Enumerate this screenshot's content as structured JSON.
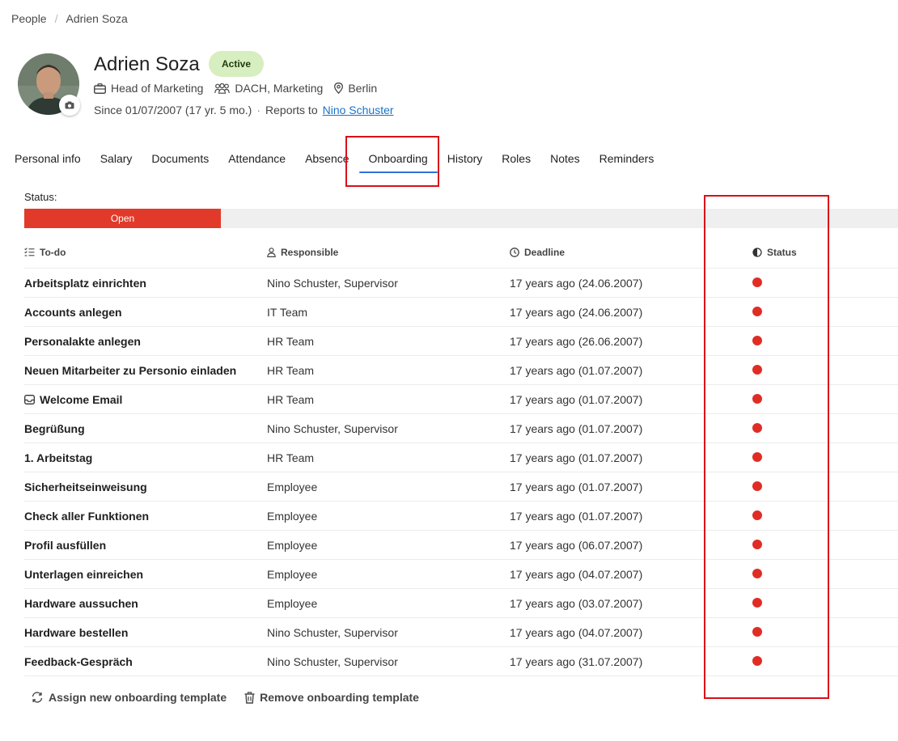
{
  "breadcrumb": {
    "root": "People",
    "current": "Adrien Soza"
  },
  "profile": {
    "name": "Adrien Soza",
    "status_badge": "Active",
    "position": "Head of Marketing",
    "department": "DACH, Marketing",
    "office": "Berlin",
    "since": "Since 01/07/2007 (17 yr. 5 mo.)",
    "reports_to_label": "Reports to",
    "reports_to_name": "Nino Schuster",
    "icons": {
      "position": "briefcase-icon",
      "department": "team-icon",
      "office": "location-pin-icon",
      "avatar_edit": "camera-icon"
    }
  },
  "tabs": [
    {
      "label": "Personal info"
    },
    {
      "label": "Salary"
    },
    {
      "label": "Documents"
    },
    {
      "label": "Attendance"
    },
    {
      "label": "Absence"
    },
    {
      "label": "Onboarding"
    },
    {
      "label": "History"
    },
    {
      "label": "Roles"
    },
    {
      "label": "Notes"
    },
    {
      "label": "Reminders"
    }
  ],
  "active_tab": "Onboarding",
  "status": {
    "label": "Status:",
    "value": "Open",
    "progress_fraction": 0.225,
    "color": "#e23a2a"
  },
  "table": {
    "headers": {
      "todo": "To-do",
      "responsible": "Responsible",
      "deadline": "Deadline",
      "status": "Status"
    },
    "rows": [
      {
        "todo": "Arbeitsplatz einrichten",
        "responsible": "Nino Schuster, Supervisor",
        "deadline": "17 years ago (24.06.2007)"
      },
      {
        "todo": "Accounts anlegen",
        "responsible": "IT Team",
        "deadline": "17 years ago (24.06.2007)"
      },
      {
        "todo": "Personalakte anlegen",
        "responsible": "HR Team",
        "deadline": "17 years ago (26.06.2007)"
      },
      {
        "todo": "Neuen Mitarbeiter zu Personio einladen",
        "responsible": "HR Team",
        "deadline": "17 years ago (01.07.2007)"
      },
      {
        "todo": "Welcome Email",
        "responsible": "HR Team",
        "deadline": "17 years ago (01.07.2007)",
        "icon": "inbox-icon"
      },
      {
        "todo": "Begrüßung",
        "responsible": "Nino Schuster, Supervisor",
        "deadline": "17 years ago (01.07.2007)"
      },
      {
        "todo": "1. Arbeitstag",
        "responsible": "HR Team",
        "deadline": "17 years ago (01.07.2007)"
      },
      {
        "todo": "Sicherheitseinweisung",
        "responsible": "Employee",
        "deadline": "17 years ago (01.07.2007)"
      },
      {
        "todo": "Check aller Funktionen",
        "responsible": "Employee",
        "deadline": "17 years ago (01.07.2007)"
      },
      {
        "todo": "Profil ausfüllen",
        "responsible": "Employee",
        "deadline": "17 years ago (06.07.2007)"
      },
      {
        "todo": "Unterlagen einreichen",
        "responsible": "Employee",
        "deadline": "17 years ago (04.07.2007)"
      },
      {
        "todo": "Hardware aussuchen",
        "responsible": "Employee",
        "deadline": "17 years ago (03.07.2007)"
      },
      {
        "todo": "Hardware bestellen",
        "responsible": "Nino Schuster, Supervisor",
        "deadline": "17 years ago (04.07.2007)"
      },
      {
        "todo": "Feedback-Gespräch",
        "responsible": "Nino Schuster, Supervisor",
        "deadline": "17 years ago (31.07.2007)"
      }
    ],
    "status_dot_color": "#df2d25"
  },
  "actions": {
    "assign": "Assign new onboarding template",
    "remove": "Remove onboarding template"
  },
  "highlight_color": "#d9101a"
}
